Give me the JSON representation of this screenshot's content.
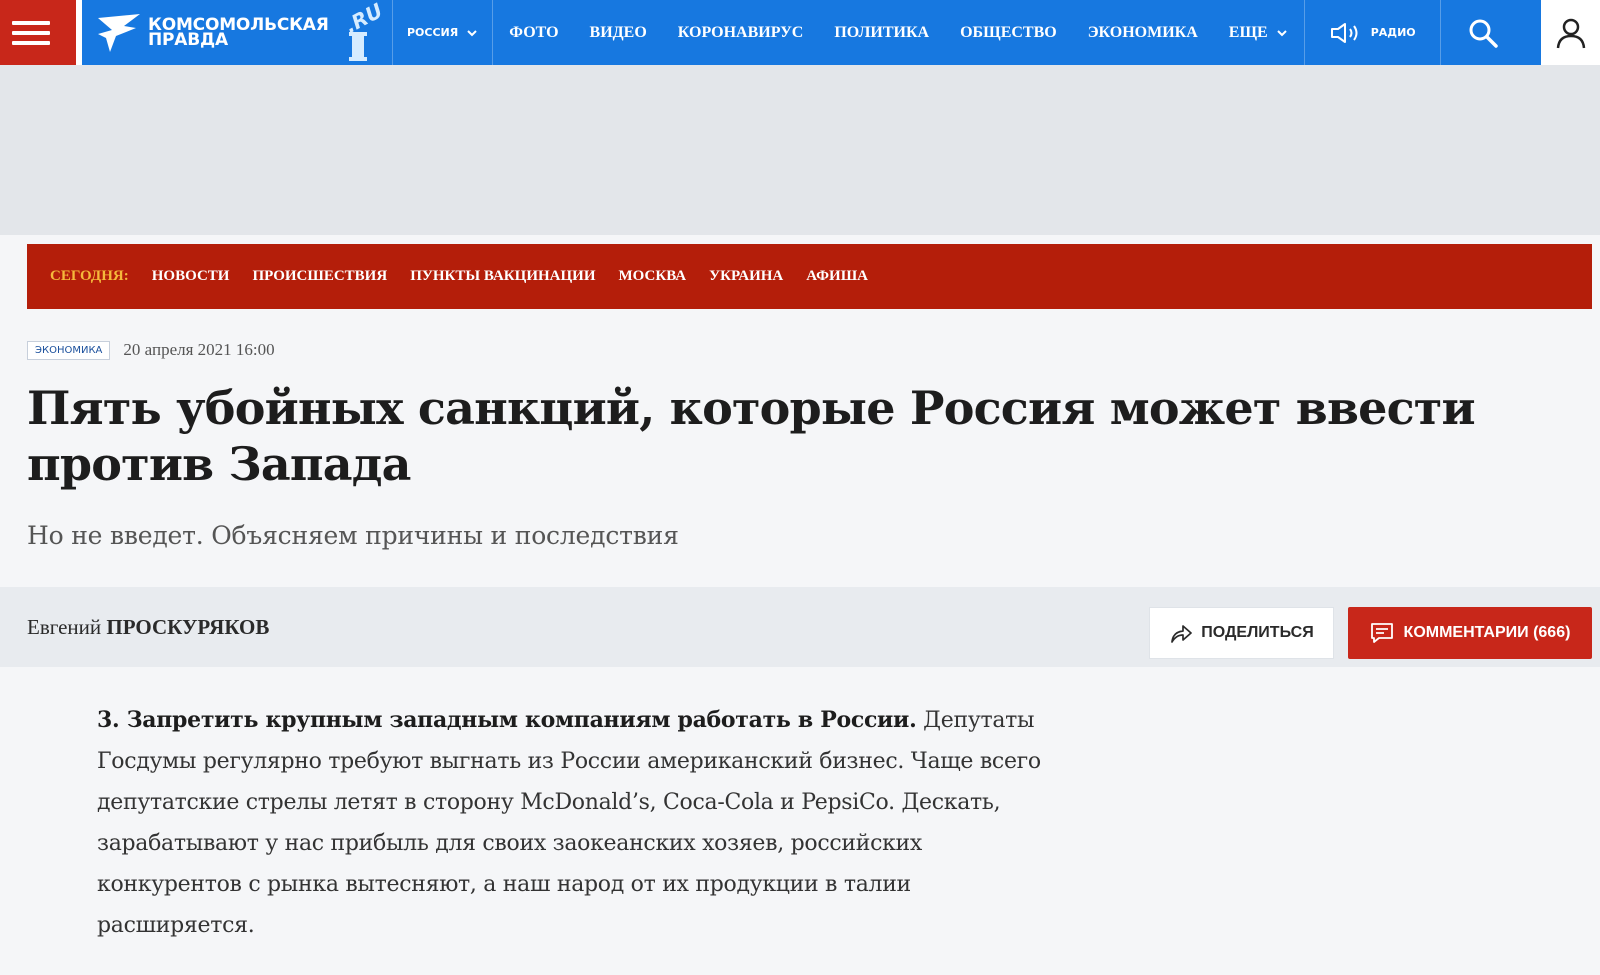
{
  "header": {
    "logo_line1": "Комсомольская",
    "logo_line2": "правда",
    "logo_suffix": ".RU",
    "region_label": "Россия",
    "nav": [
      "Фото",
      "Видео",
      "Коронавирус",
      "Политика",
      "Общество",
      "Экономика"
    ],
    "more_label": "Еще",
    "radio_label": "Радио",
    "brand_color": "#1778e0",
    "accent_color": "#c8271a"
  },
  "today_bar": {
    "label": "Сегодня:",
    "links": [
      "Новости",
      "Происшествия",
      "Пункты вакцинации",
      "Москва",
      "Украина",
      "Афиша"
    ]
  },
  "article": {
    "rubric": "Экономика",
    "date": "20 апреля 2021 16:00",
    "title": "Пять убойных санкций, которые Россия может ввести против Запада",
    "subtitle": "Но не введет. Объясняем причины и последствия",
    "author_first": "Евгений",
    "author_last": "ПРОСКУРЯКОВ",
    "share_label": "Поделиться",
    "comments_label": "Комментарии (666)",
    "para_lead": "3. Запретить крупным западным компаниям работать в России.",
    "para_text": " Депутаты Госдумы регулярно требуют выгнать из России американский бизнес. Чаще всего депутатские стрелы летят в сторону McDonald’s, Coca-Cola и PepsiCo. Дескать, зарабатывают у нас прибыль для своих заокеанских хозяев, российских конкурентов с рынка вытесняют, а наш народ от их продукции в талии расширяется."
  }
}
